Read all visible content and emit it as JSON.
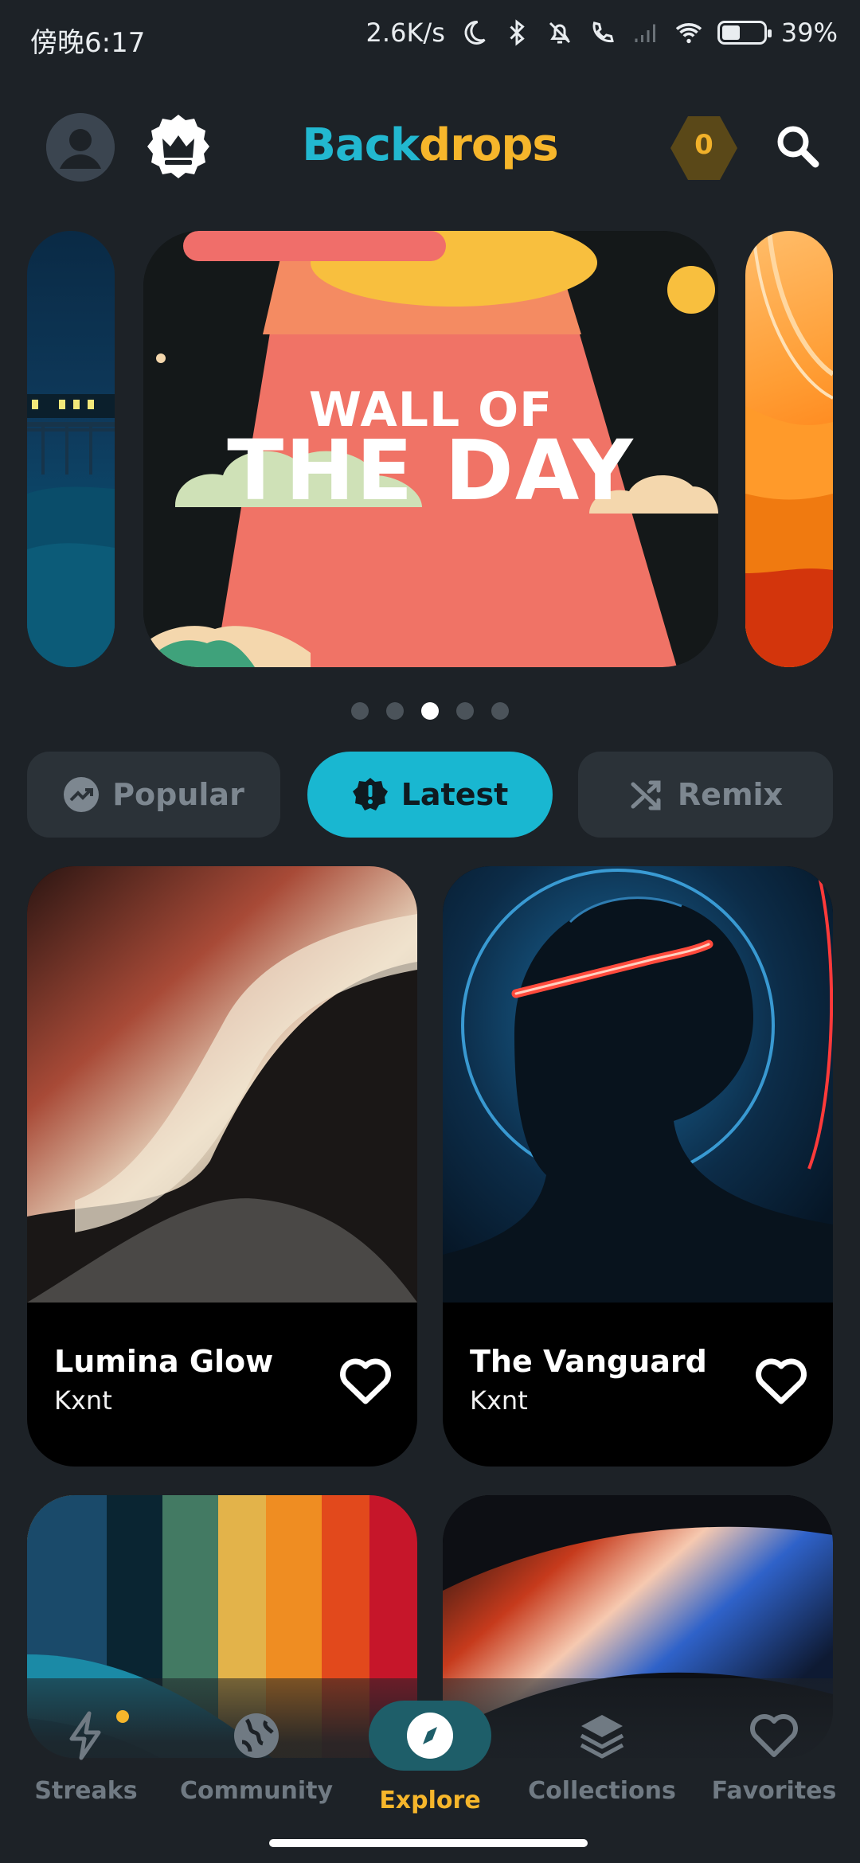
{
  "status_bar": {
    "time": "傍晚6:17",
    "speed": "2.6K/s",
    "battery": "39%"
  },
  "header": {
    "brand_part1": "Back",
    "brand_part2": "drops",
    "coins": "0"
  },
  "carousel": {
    "banner_line1": "WALL OF",
    "banner_line2": "THE DAY",
    "page_count": 5,
    "active_page": 3
  },
  "tabs": [
    {
      "label": "Popular",
      "icon": "trending-up-icon",
      "active": false
    },
    {
      "label": "Latest",
      "icon": "badge-alert-icon",
      "active": true
    },
    {
      "label": "Remix",
      "icon": "shuffle-icon",
      "active": false
    }
  ],
  "wallpapers": [
    {
      "title": "Lumina Glow",
      "author": "Kxnt"
    },
    {
      "title": "The Vanguard",
      "author": "Kxnt"
    }
  ],
  "nav": {
    "items": [
      {
        "label": "Streaks",
        "icon": "lightning-icon"
      },
      {
        "label": "Community",
        "icon": "globe-icon"
      },
      {
        "label": "Explore",
        "icon": "compass-icon"
      },
      {
        "label": "Collections",
        "icon": "layers-icon"
      },
      {
        "label": "Favorites",
        "icon": "heart-icon"
      }
    ],
    "active": "Explore"
  },
  "colors": {
    "background": "#1d2227",
    "accent_cyan": "#19b7d1",
    "accent_yellow": "#f6b62b"
  }
}
